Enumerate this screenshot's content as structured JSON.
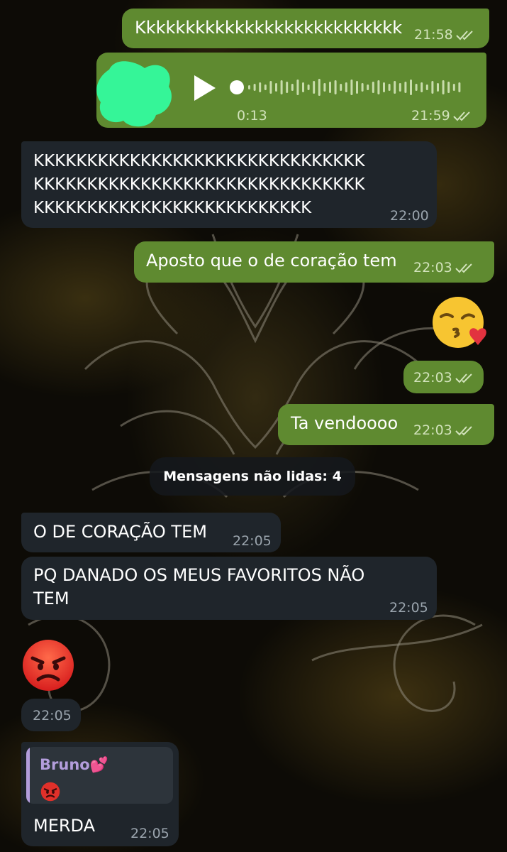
{
  "messages": {
    "m1": {
      "text": "Kkkkkkkkkkkkkkkkkkkkkkkkkkk",
      "time": "21:58"
    },
    "voice": {
      "duration": "0:13",
      "time": "21:59"
    },
    "m2": {
      "text": "KKKKKKKKKKKKKKKKKKKKKKKKKKKKKKK\nKKKKKKKKKKKKKKKKKKKKKKKKKKKKKKK\nKKKKKKKKKKKKKKKKKKKKKKKKKK",
      "time": "22:00"
    },
    "m3": {
      "text": "Aposto que o de coração tem",
      "time": "22:03"
    },
    "m4": {
      "emoji": "face-blowing-kiss",
      "time": "22:03"
    },
    "m5": {
      "text": "Ta vendoooo",
      "time": "22:03"
    },
    "unread": "Mensagens não lidas: 4",
    "m6": {
      "text": "O DE CORAÇÃO TEM",
      "time": "22:05"
    },
    "m7": {
      "text": "PQ DANADO OS MEUS FAVORITOS NÃO\nTEM",
      "time": "22:05"
    },
    "m8": {
      "emoji": "pouting-face",
      "time": "22:05"
    },
    "m9": {
      "reply_name": "Bruno💕",
      "reply_emoji": "pouting-face",
      "text": "MERDA",
      "time": "22:05"
    }
  },
  "colors": {
    "outgoing_bubble": "#5f8a30",
    "incoming_bubble": "#1f252b",
    "reply_accent": "#b39ddb",
    "redacted_blob": "#35f598"
  }
}
